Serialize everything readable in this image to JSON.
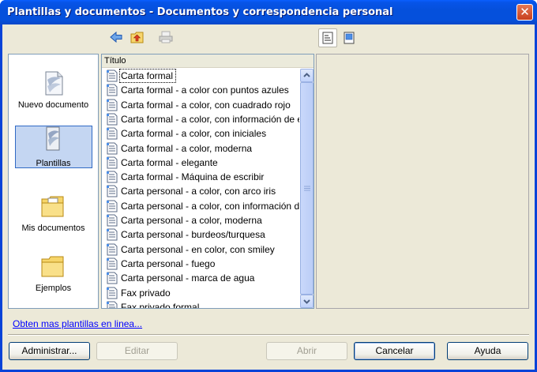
{
  "window": {
    "title": "Plantillas y documentos - Documentos y correspondencia personal",
    "close_glyph": "✕"
  },
  "toolbar": {
    "back_icon": "back-arrow-icon",
    "up_icon": "folder-up-icon",
    "print_icon": "print-icon",
    "doc_props_icon": "document-properties-icon",
    "preview_icon": "preview-icon"
  },
  "categories": [
    {
      "label": "Nuevo documento",
      "icon": "new-document-icon",
      "selected": false
    },
    {
      "label": "Plantillas",
      "icon": "templates-icon",
      "selected": true
    },
    {
      "label": "Mis documentos",
      "icon": "my-documents-icon",
      "selected": false
    },
    {
      "label": "Ejemplos",
      "icon": "examples-folder-icon",
      "selected": false
    }
  ],
  "list": {
    "header": "Título",
    "items": [
      "Carta formal",
      "Carta formal - a color con puntos azules",
      "Carta formal - a color, con cuadrado rojo",
      "Carta formal - a color, con información de e",
      "Carta formal - a color, con iniciales",
      "Carta formal - a color, moderna",
      "Carta formal - elegante",
      "Carta formal - Máquina de escribir",
      "Carta personal - a color, con arco iris",
      "Carta personal - a color, con información de",
      "Carta personal - a color, moderna",
      "Carta personal - burdeos/turquesa",
      "Carta personal - en color, con smiley",
      "Carta personal - fuego",
      "Carta personal - marca de agua",
      "Fax privado",
      "Fax privado formal"
    ]
  },
  "footer": {
    "link": "Obten mas plantillas en linea...",
    "buttons": {
      "manage": "Administrar...",
      "edit": "Editar",
      "open": "Abrir",
      "cancel": "Cancelar",
      "help": "Ayuda"
    }
  },
  "colors": {
    "titlebar": "#0550dc",
    "dialog_bg": "#ece9d8",
    "selection": "#c4d6f2",
    "link": "#0000ff"
  }
}
